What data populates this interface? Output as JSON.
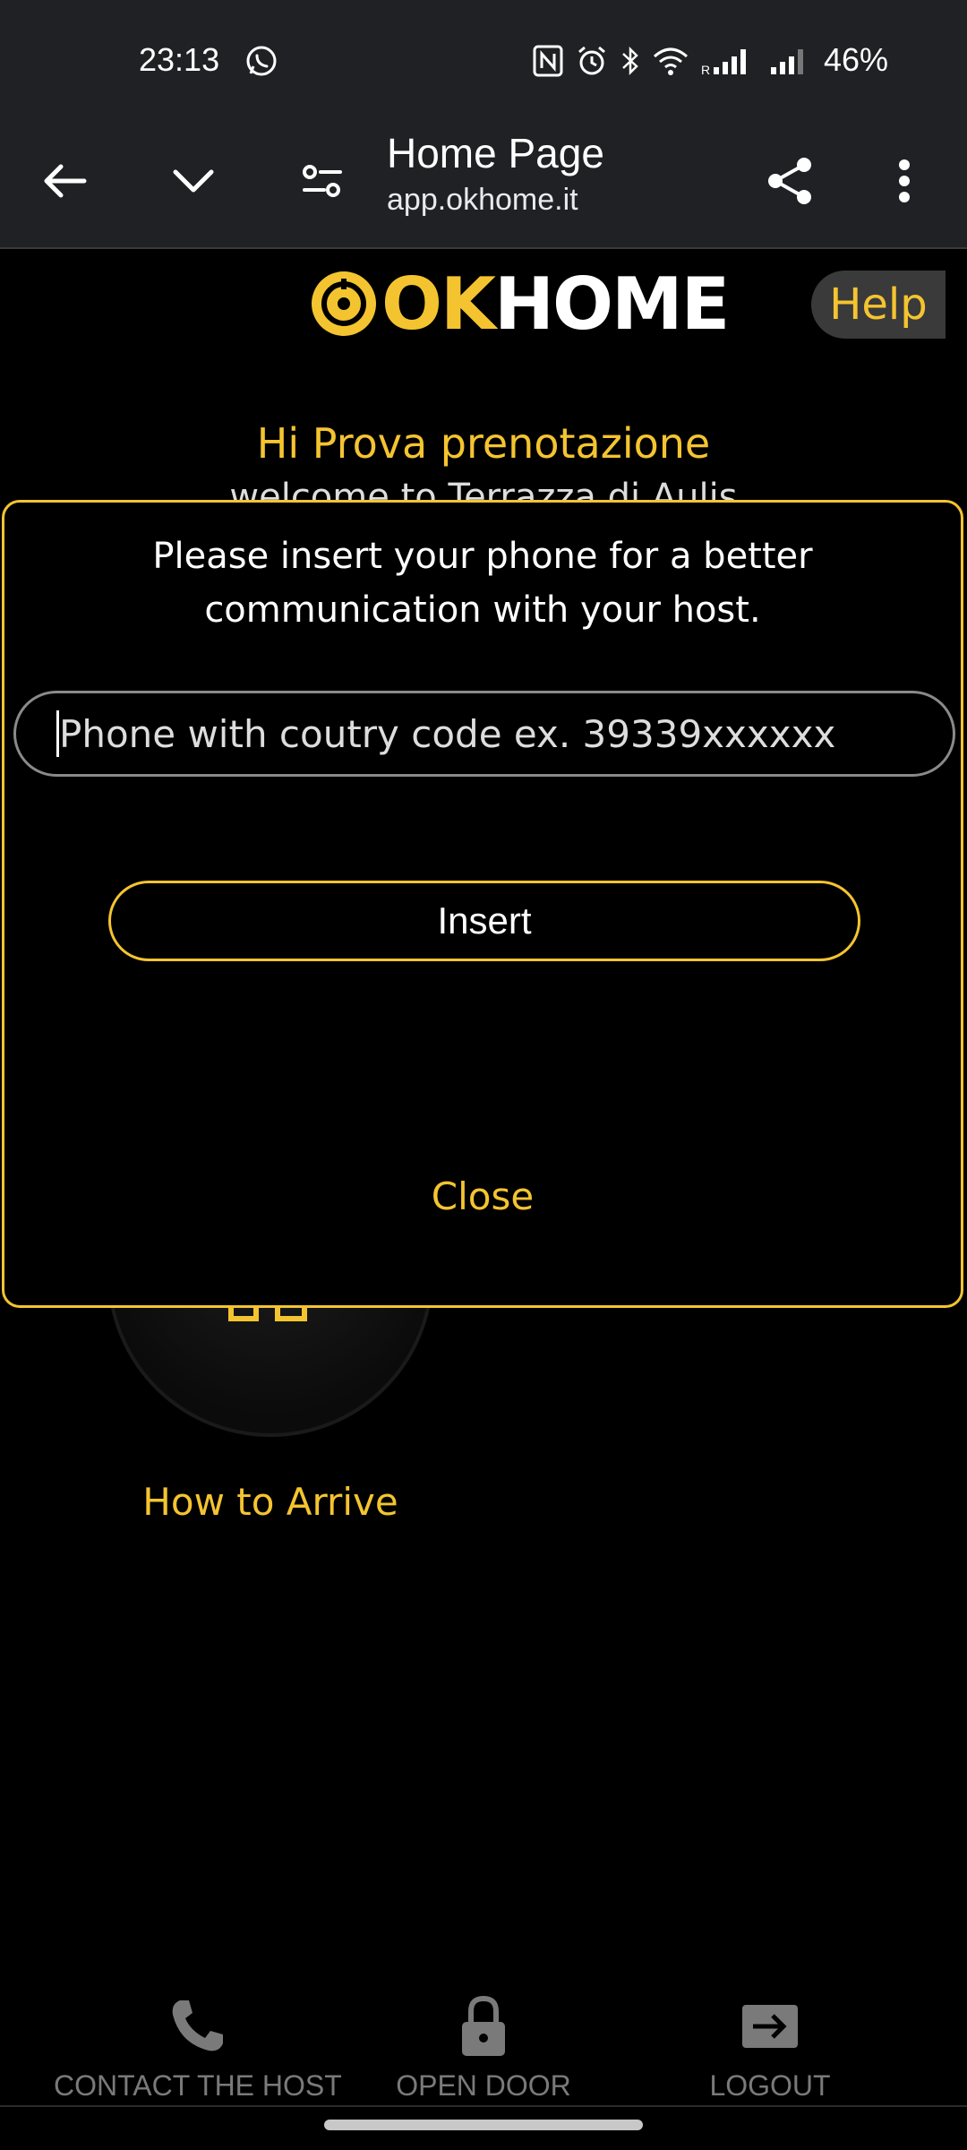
{
  "status_bar": {
    "time": "23:13",
    "battery": "46%"
  },
  "browser": {
    "title": "Home Page",
    "url": "app.okhome.it"
  },
  "page": {
    "logo_ok": "OK",
    "logo_home": "HOME",
    "help": "Help",
    "greeting": "Hi Prova prenotazione",
    "subtitle": "welcome to Terrazza di Aulis"
  },
  "modal": {
    "message": "Please insert your phone for a better communication with your host.",
    "input_placeholder": "Phone with coutry code ex. 39339xxxxxx",
    "insert_label": "Insert",
    "close_label": "Close"
  },
  "arrive": {
    "label": "How to Arrive"
  },
  "nav": {
    "contact": "CONTACT THE HOST",
    "open_door": "OPEN DOOR",
    "logout": "LOGOUT"
  },
  "colors": {
    "accent": "#f4c430",
    "background": "#000000",
    "bar": "#202124"
  }
}
